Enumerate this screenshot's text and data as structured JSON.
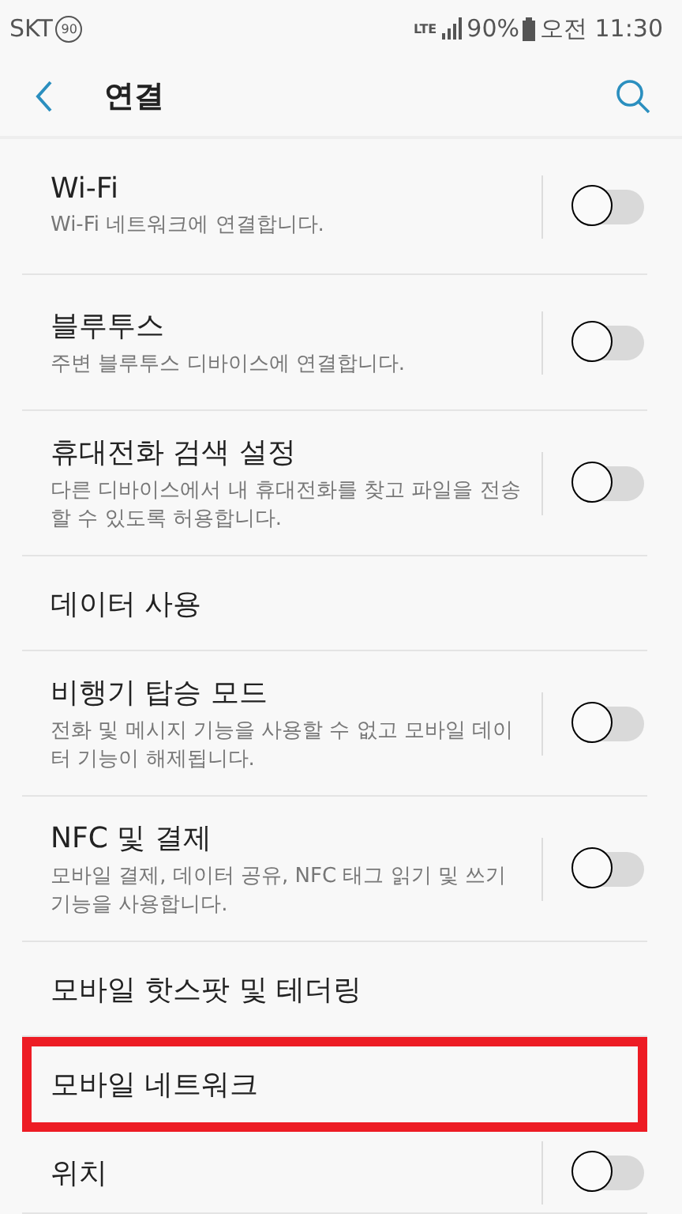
{
  "status_bar": {
    "carrier": "SKT",
    "carrier_badge": "90",
    "network": "LTE",
    "battery": "90%",
    "time": "오전 11:30"
  },
  "header": {
    "title": "연결"
  },
  "items": [
    {
      "title": "Wi-Fi",
      "subtitle": "Wi-Fi 네트워크에 연결합니다.",
      "kind": "toggle",
      "on": false,
      "highlighted": false
    },
    {
      "title": "블루투스",
      "subtitle": "주변 블루투스 디바이스에 연결합니다.",
      "kind": "toggle",
      "on": false,
      "highlighted": false
    },
    {
      "title": "휴대전화 검색 설정",
      "subtitle": "다른 디바이스에서 내 휴대전화를 찾고 파일을 전송할 수 있도록 허용합니다.",
      "kind": "toggle",
      "on": false,
      "highlighted": false
    },
    {
      "title": "데이터 사용",
      "kind": "link",
      "highlighted": false
    },
    {
      "title": "비행기 탑승 모드",
      "subtitle": "전화 및 메시지 기능을 사용할 수 없고 모바일 데이터 기능이 해제됩니다.",
      "kind": "toggle",
      "on": false,
      "highlighted": false
    },
    {
      "title": "NFC 및 결제",
      "subtitle": "모바일 결제, 데이터 공유, NFC 태그 읽기 및 쓰기 기능을 사용합니다.",
      "kind": "toggle",
      "on": false,
      "highlighted": false
    },
    {
      "title": "모바일 핫스팟 및 테더링",
      "kind": "link",
      "highlighted": false
    },
    {
      "title": "모바일 네트워크",
      "kind": "link",
      "highlighted": true
    },
    {
      "title": "위치",
      "kind": "toggle",
      "on": false,
      "highlighted": false
    }
  ]
}
